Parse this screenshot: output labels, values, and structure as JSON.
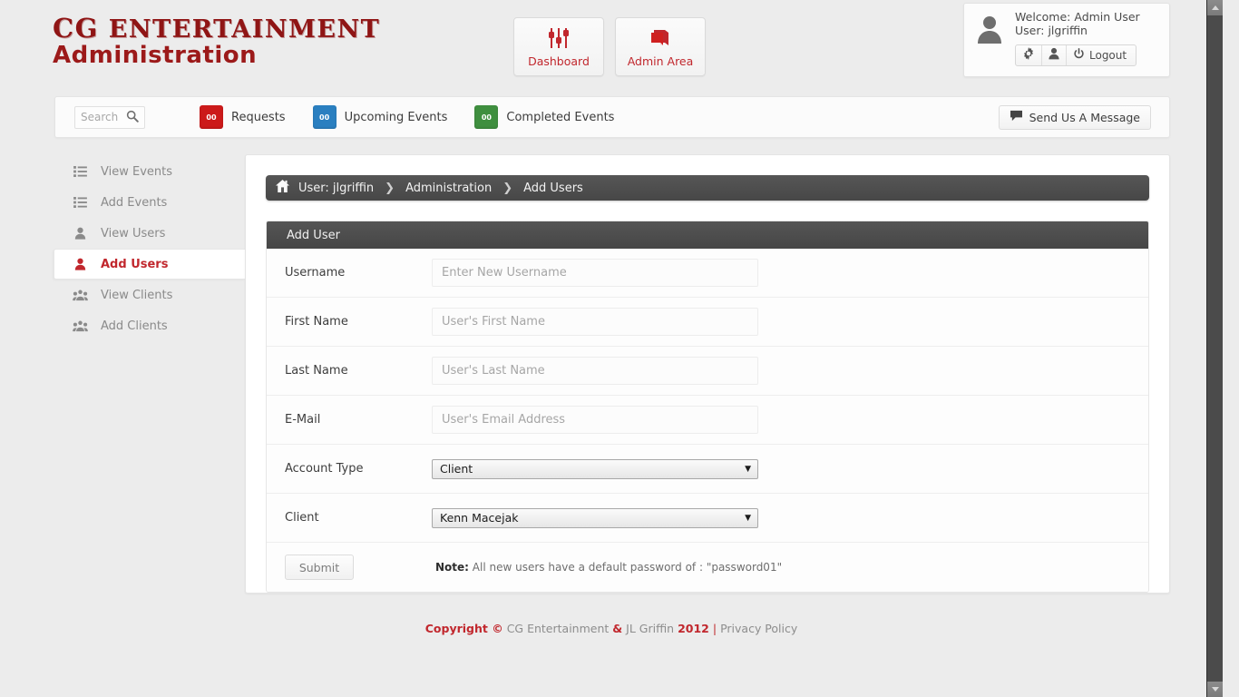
{
  "brand": {
    "logo_line1_cg": "CG",
    "logo_line1_rest": "ENTERTAINMENT",
    "logo_line2": "Administration",
    "accent_red": "#c1272d",
    "logo_red": "#8f1515"
  },
  "header": {
    "nav_buttons": [
      {
        "label": "Dashboard",
        "icon": "sliders-icon"
      },
      {
        "label": "Admin Area",
        "icon": "books-icon"
      }
    ],
    "user": {
      "welcome_line": "Welcome: Admin User",
      "user_line": "User: jlgriffin",
      "avatar_icon": "user-avatar-icon",
      "actions": [
        {
          "label": "",
          "icon": "gear-icon"
        },
        {
          "label": "",
          "icon": "person-icon"
        },
        {
          "label": "Logout",
          "icon": "power-icon"
        }
      ]
    }
  },
  "toolbar": {
    "search_placeholder": "Search",
    "search_icon": "search-icon",
    "links": [
      {
        "label": "Requests",
        "count": "00",
        "color": "#cc1a1a"
      },
      {
        "label": "Upcoming Events",
        "count": "00",
        "color": "#2a7fc0"
      },
      {
        "label": "Completed Events",
        "count": "00",
        "color": "#3f8f3f"
      }
    ],
    "message_button": {
      "label": "Send Us A Message",
      "icon": "comment-icon"
    }
  },
  "sidebar": {
    "items": [
      {
        "label": "View Events",
        "icon": "list-icon",
        "active": false
      },
      {
        "label": "Add Events",
        "icon": "list-icon",
        "active": false
      },
      {
        "label": "View Users",
        "icon": "person-icon",
        "active": false
      },
      {
        "label": "Add Users",
        "icon": "person-icon",
        "active": true
      },
      {
        "label": "View Clients",
        "icon": "group-icon",
        "active": false
      },
      {
        "label": "Add Clients",
        "icon": "group-icon",
        "active": false
      }
    ]
  },
  "breadcrumb": {
    "home_icon": "home-icon",
    "items": [
      "User: jlgriffin",
      "Administration",
      "Add Users"
    ],
    "separator": "❯"
  },
  "panel": {
    "title": "Add User",
    "fields": [
      {
        "label": "Username",
        "type": "text",
        "value": "",
        "placeholder": "Enter New Username"
      },
      {
        "label": "First Name",
        "type": "text",
        "value": "",
        "placeholder": "User's First Name"
      },
      {
        "label": "Last Name",
        "type": "text",
        "value": "",
        "placeholder": "User's Last Name"
      },
      {
        "label": "E-Mail",
        "type": "text",
        "value": "",
        "placeholder": "User's Email Address"
      },
      {
        "label": "Account Type",
        "type": "select",
        "value": "Client"
      },
      {
        "label": "Client",
        "type": "select",
        "value": "Kenn Macejak"
      }
    ],
    "submit_label": "Submit",
    "note_prefix": "Note:",
    "note_text": " All new users have a default password of :  \"password01\""
  },
  "footer": {
    "copyright": "Copyright ©",
    "company": "CG Entertainment",
    "amp": "&",
    "author": "JL Griffin",
    "year": "2012",
    "divider": "|",
    "privacy": "Privacy Policy"
  },
  "scrollbar": {
    "up_icon": "scroll-up-arrow-icon",
    "down_icon": "scroll-down-arrow-icon"
  }
}
